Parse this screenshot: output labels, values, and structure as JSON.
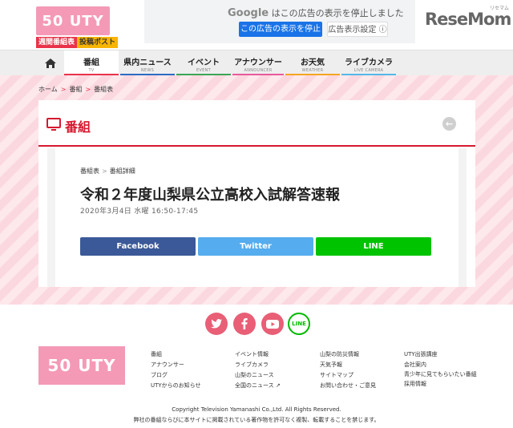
{
  "header": {
    "logo_text": "50 UTY",
    "tag_weekly": "週間番組表",
    "tag_post": "投稿ポスト",
    "brand": "ReseMom",
    "brand_kana": "リセマム"
  },
  "ad": {
    "google": "Google",
    "message": "はこの広告の表示を停止しました",
    "stop_label": "この広告の表示を停止",
    "settings_label": "広告表示設定 ⓘ"
  },
  "nav": {
    "items": [
      {
        "jp": "番組",
        "en": "TV",
        "color": "#e8334a"
      },
      {
        "jp": "県内ニュース",
        "en": "NEWS",
        "color": "#2b6cc4"
      },
      {
        "jp": "イベント",
        "en": "EVENT",
        "color": "#3aa655"
      },
      {
        "jp": "アナウンサー",
        "en": "ANNOUNCER",
        "color": "#e85a9b"
      },
      {
        "jp": "お天気",
        "en": "WEATHER",
        "color": "#f5a623"
      },
      {
        "jp": "ライブカメラ",
        "en": "LIVE CAMERA",
        "color": "#55b7e8"
      }
    ]
  },
  "breadcrumb": {
    "home": "ホーム",
    "section": "番組",
    "current": "番組表"
  },
  "card": {
    "title": "番組",
    "sub_crumb_parent": "番組表",
    "sub_crumb_current": "番組詳細",
    "program_title": "令和２年度山梨県公立高校入試解答速報",
    "program_date": "2020年3月4日 水曜 16:50-17:45"
  },
  "share": {
    "facebook": "Facebook",
    "twitter": "Twitter",
    "line": "LINE"
  },
  "footer": {
    "social_line": "LINE",
    "logo_text": "50 UTY",
    "col1": [
      "番組",
      "アナウンサー",
      "ブログ",
      "UTYからのお知らせ"
    ],
    "col2": [
      "イベント情報",
      "ライブカメラ",
      "山梨のニュース",
      "全国のニュース ↗"
    ],
    "col3": [
      "山梨の防災情報",
      "天気予報",
      "サイトマップ",
      "お問い合わせ・ご意見"
    ],
    "col4": [
      "UTY出張講座",
      "会社案内",
      "青少年に見てもらいたい番組",
      "採用情報"
    ],
    "copyright": "Copyright Television Yamanashi Co.,Ltd. All Rights Reserved.",
    "notice": "弊社の番組ならびに本サイトに掲載されている著作物を許可なく複製、転載することを禁じます。"
  },
  "colors": {
    "accent_red": "#d6192f",
    "brand_pink": "#f49ab6",
    "facebook": "#3b5998",
    "twitter": "#55acee",
    "line": "#00c300"
  }
}
